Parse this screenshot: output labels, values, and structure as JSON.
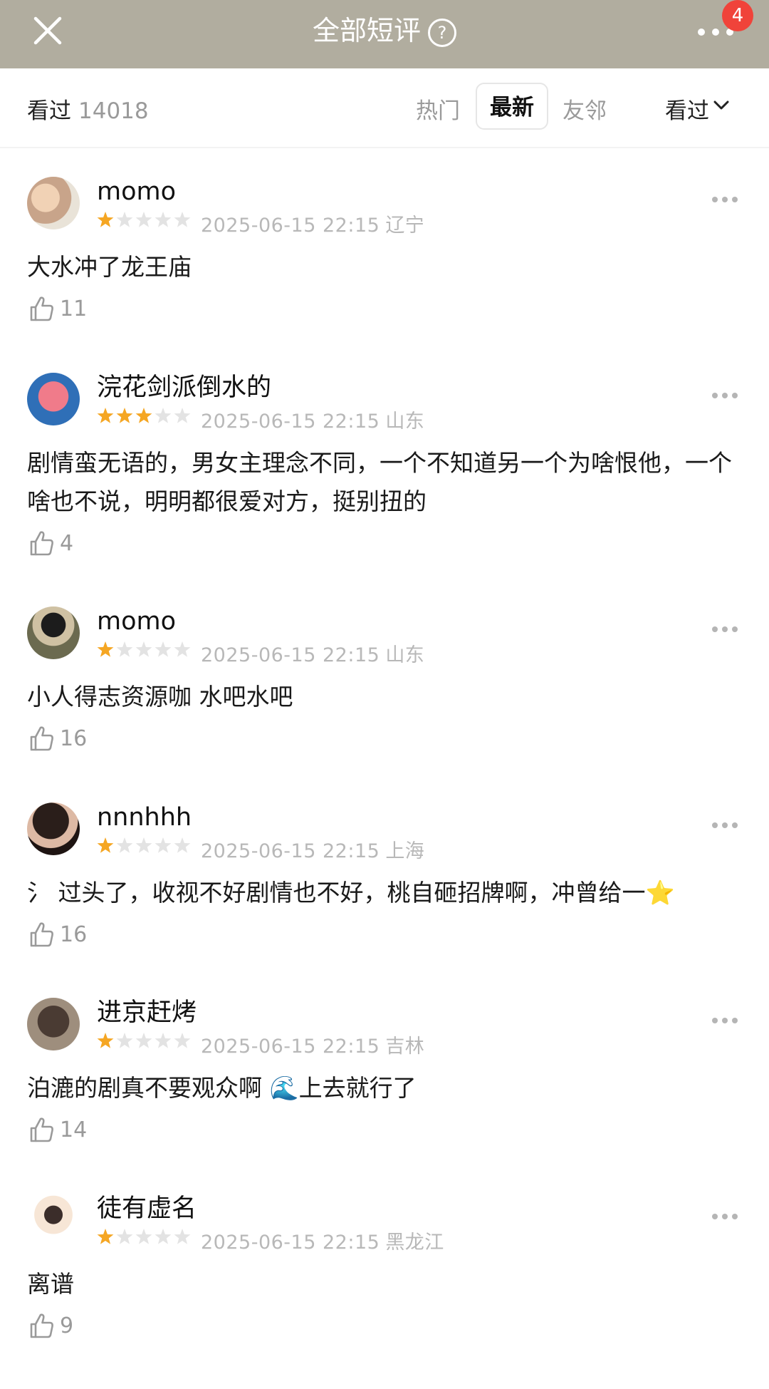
{
  "header": {
    "title": "全部短评",
    "help_icon": "question-circle-icon",
    "more_icon": "more-dots-icon",
    "badge_count": "4"
  },
  "filter": {
    "seen_label": "看过",
    "seen_count": "14018",
    "tabs": [
      {
        "label": "热门"
      },
      {
        "label": "最新",
        "active": true
      },
      {
        "label": "友邻"
      }
    ],
    "dropdown_label": "看过"
  },
  "comments": [
    {
      "user": "momo",
      "rating": 1,
      "date": "2025-06-15 22:15",
      "location": "辽宁",
      "text": "大水冲了龙王庙",
      "likes": "11"
    },
    {
      "user": "浣花剑派倒水的",
      "rating": 3,
      "date": "2025-06-15 22:15",
      "location": "山东",
      "text": "剧情蛮无语的，男女主理念不同，一个不知道另一个为啥恨他，一个啥也不说，明明都很爱对方，挺别扭的",
      "likes": "4"
    },
    {
      "user": "momo",
      "rating": 1,
      "date": "2025-06-15 22:15",
      "location": "山东",
      "text": "小人得志资源咖 水吧水吧",
      "likes": "16"
    },
    {
      "user": "nnnhhh",
      "rating": 1,
      "date": "2025-06-15 22:15",
      "location": "上海",
      "text": "氵 过头了，收视不好剧情也不好，桃自砸招牌啊，冲曾给一⭐",
      "likes": "16"
    },
    {
      "user": "进京赶烤",
      "rating": 1,
      "date": "2025-06-15 22:15",
      "location": "吉林",
      "text": "泊漉的剧真不要观众啊 🌊上去就行了",
      "likes": "14"
    },
    {
      "user": "徒有虚名",
      "rating": 1,
      "date": "2025-06-15 22:15",
      "location": "黑龙江",
      "text": "离谱",
      "likes": "9"
    }
  ],
  "colors": {
    "header_bg": "#b1ad9f",
    "star_on": "#f5a623",
    "star_off": "#e3e3e3",
    "badge": "#f0433a"
  }
}
